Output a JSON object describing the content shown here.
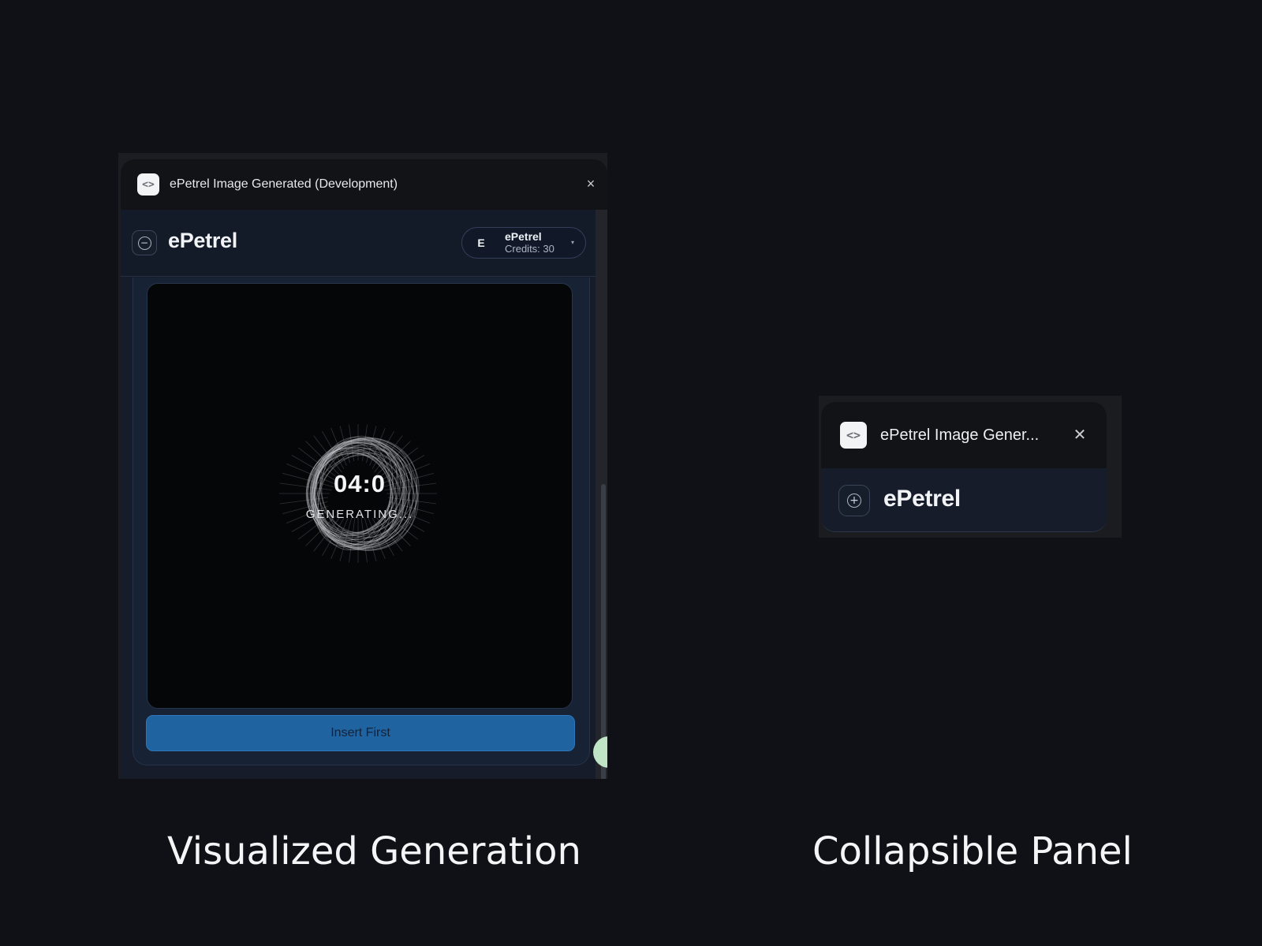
{
  "expanded_panel": {
    "window_title": "ePetrel Image Generated (Development)",
    "close_icon": "×",
    "app_icon": "code-brackets-icon",
    "header": {
      "collapse_icon": "−",
      "brand": "ePetrel",
      "user": {
        "avatar_letter": "E",
        "name": "ePetrel",
        "credits": "Credits: 30",
        "caret": "▾"
      }
    },
    "preview": {
      "timer": "04:0",
      "status": "GENERATING..."
    },
    "insert_button": "Insert First"
  },
  "collapsed_panel": {
    "window_title": "ePetrel Image Gener...",
    "close_icon": "✕",
    "app_icon": "code-brackets-icon",
    "expand_icon": "+",
    "brand": "ePetrel"
  },
  "captions": {
    "left": "Visualized Generation",
    "right": "Collapsible Panel"
  },
  "colors": {
    "background": "#0f1116",
    "panel_body": "#161c29",
    "accent_button": "#1f63a1"
  }
}
